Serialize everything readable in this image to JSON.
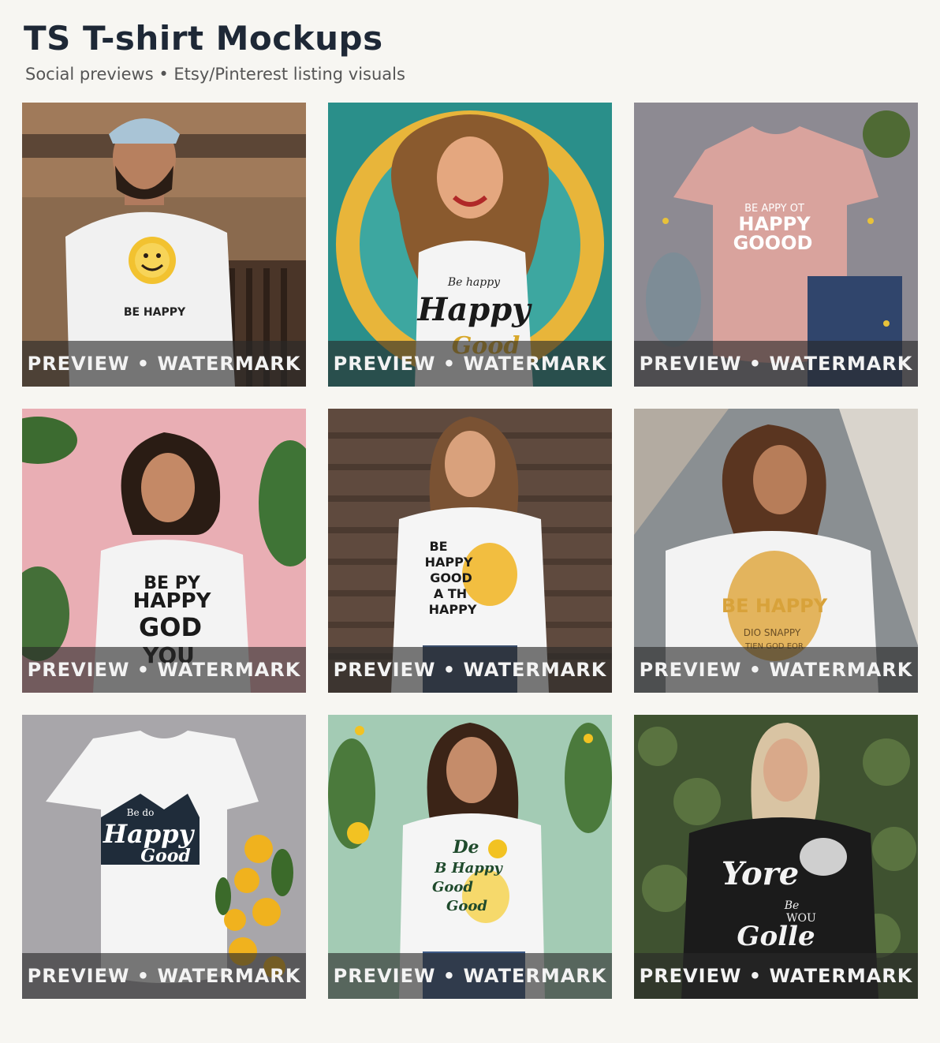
{
  "header": {
    "title": "TS T-shirt Mockups",
    "subtitle": "Social previews • Etsy/Pinterest listing visuals"
  },
  "watermark_label": "PREVIEW • WATERMARK",
  "mockups": [
    {
      "name": "man-cap-sun-smiley",
      "shirt_text": [
        "BE HAPPY"
      ]
    },
    {
      "name": "illustrated-woman-happy-good",
      "shirt_text": [
        "Be happy",
        "Happy",
        "Good"
      ]
    },
    {
      "name": "pink-shirt-flatlay",
      "shirt_text": [
        "BE APPY OT",
        "HAPPY",
        "GOOOD"
      ]
    },
    {
      "name": "woman-pink-wall",
      "shirt_text": [
        "BE PY",
        "HAPPY",
        "GOD",
        "YOU"
      ]
    },
    {
      "name": "woman-wood-wall-smiley",
      "shirt_text": [
        "BE",
        "HAPPY",
        "GOOD",
        "A TH",
        "HAPPY"
      ]
    },
    {
      "name": "woman-curly-be-happy",
      "shirt_text": [
        "BE HAPPY",
        "DIO SNAPPY",
        "TIEN GOD EOR"
      ]
    },
    {
      "name": "white-shirt-sunflowers",
      "shirt_text": [
        "Be do",
        "Happy",
        "Good"
      ]
    },
    {
      "name": "woman-mint-bg",
      "shirt_text": [
        "De",
        "B Happy",
        "Good",
        "Good"
      ]
    },
    {
      "name": "blonde-black-shirt",
      "shirt_text": [
        "Yore",
        "Be",
        "WOU",
        "Golle"
      ]
    }
  ]
}
